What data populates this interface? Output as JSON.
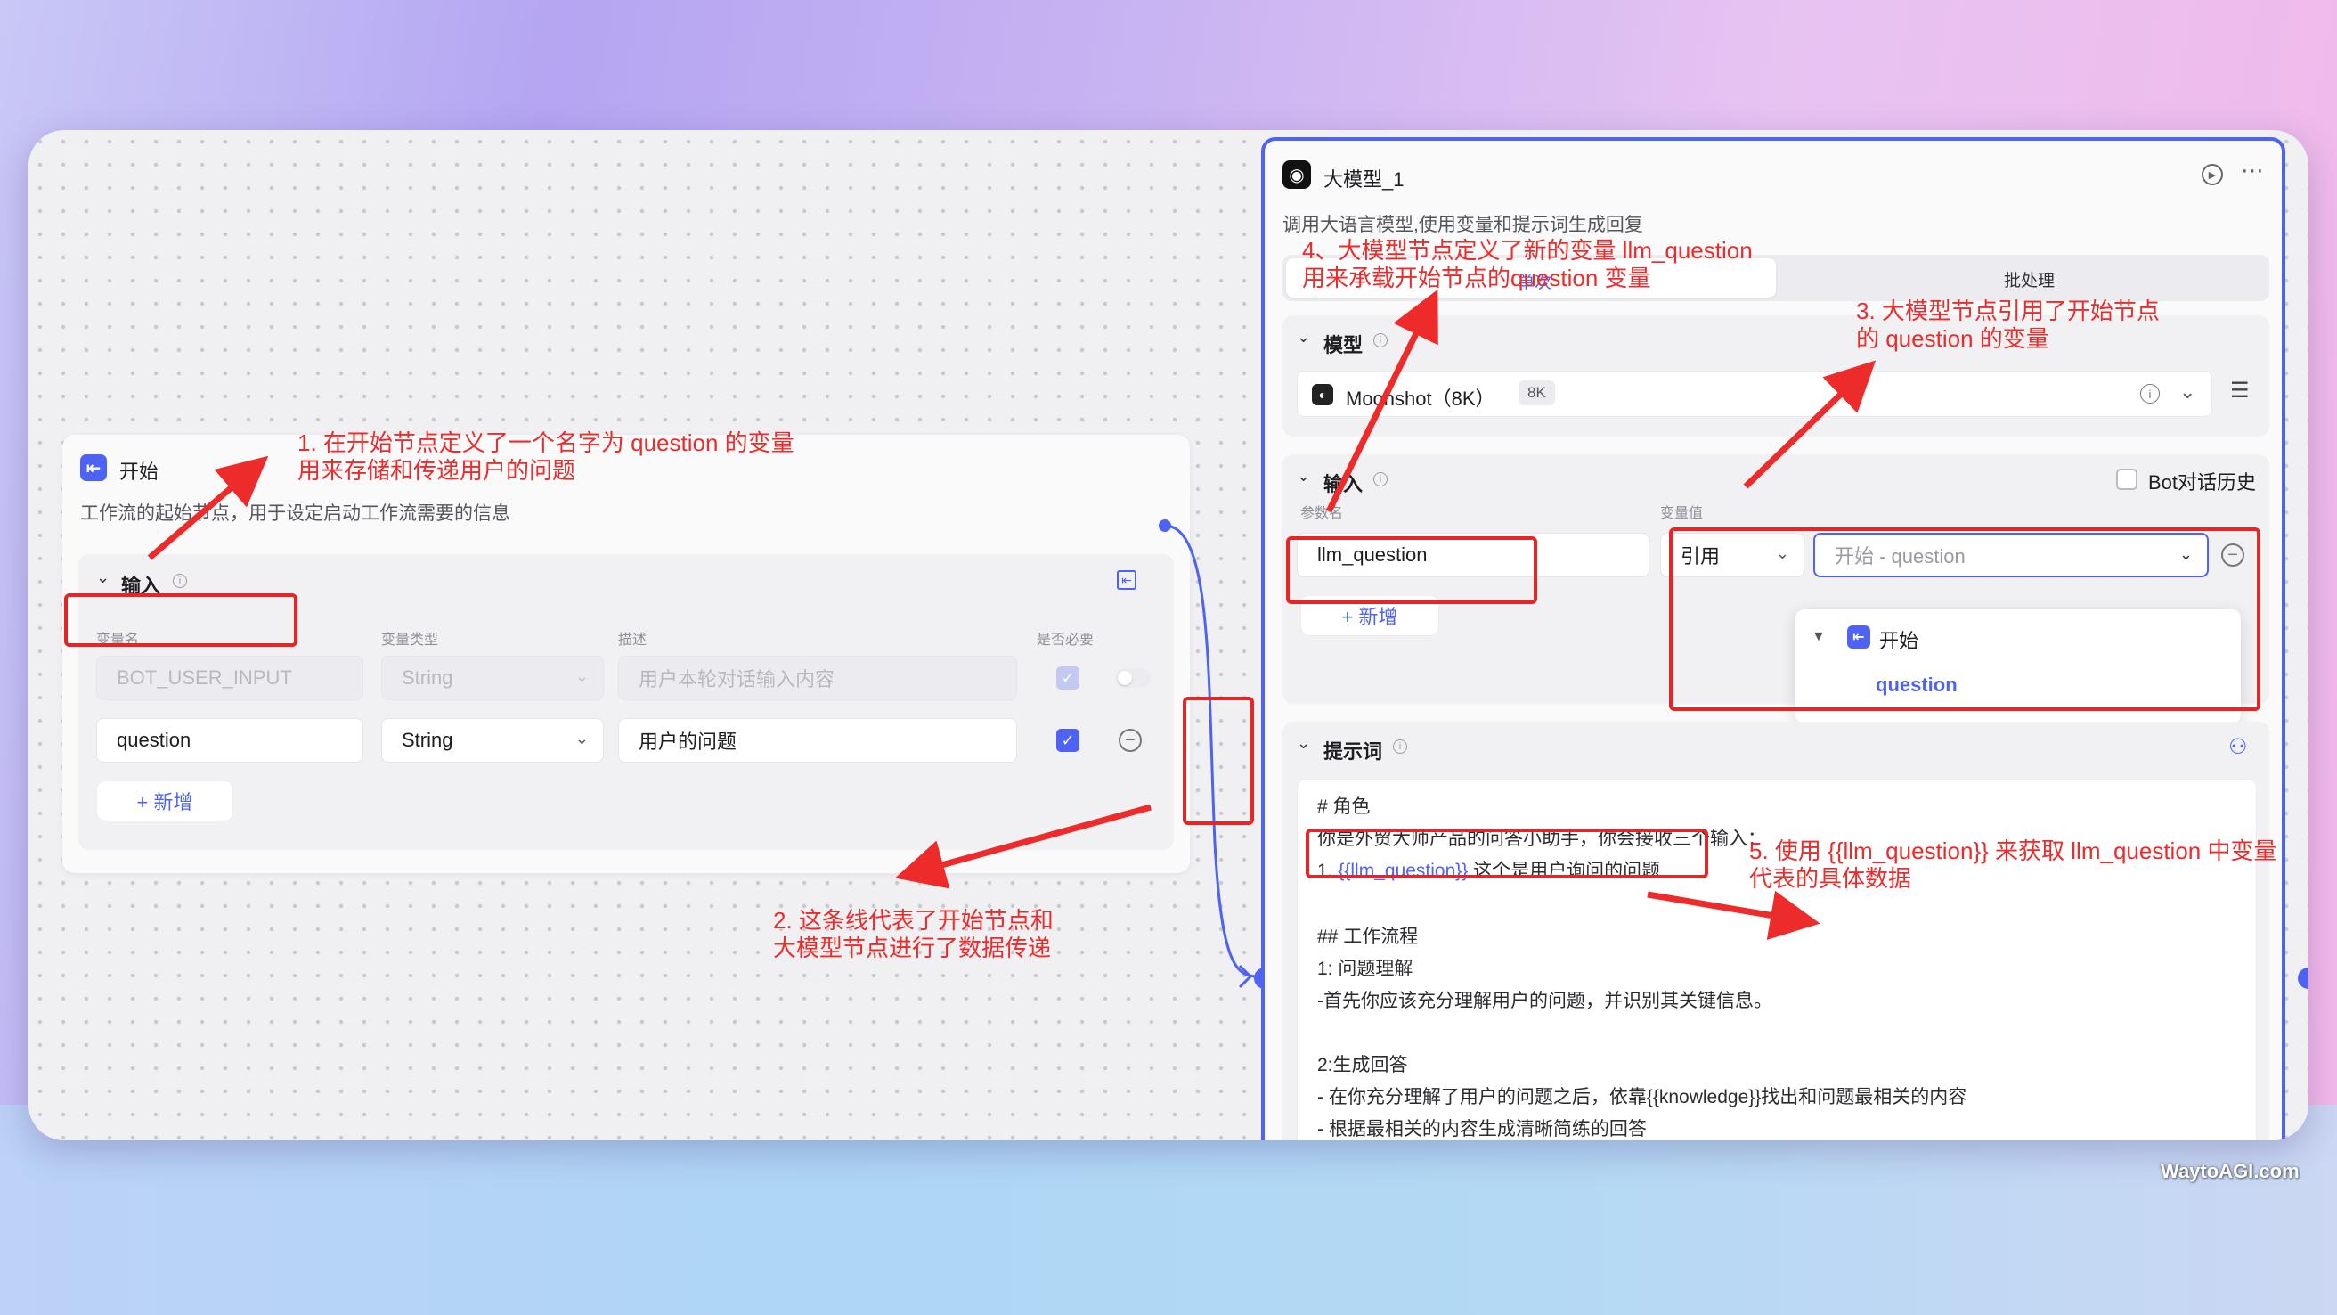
{
  "start_node": {
    "title": "开始",
    "description": "工作流的起始节点，用于设定启动工作流需要的信息",
    "input_section": {
      "title": "输入",
      "col_name": "变量名",
      "col_type": "变量类型",
      "col_desc": "描述",
      "col_required": "是否必要",
      "rows": [
        {
          "name": "BOT_USER_INPUT",
          "type": "String",
          "desc": "用户本轮对话输入内容"
        },
        {
          "name": "question",
          "type": "String",
          "desc": "用户的问题"
        }
      ],
      "add_label": "+ 新增"
    }
  },
  "llm_node": {
    "title": "大模型_1",
    "description": "调用大语言模型,使用变量和提示词生成回复",
    "tab_single": "单次",
    "tab_batch": "批处理",
    "model_section": {
      "title": "模型",
      "model_name": "Moonshot（8K）",
      "badge": "8K"
    },
    "input_section": {
      "title": "输入",
      "bot_history_label": "Bot对话历史",
      "col_param": "参数名",
      "col_value": "变量值",
      "param_name": "llm_question",
      "ref_type": "引用",
      "ref_value": "开始 - question",
      "add_label": "+ 新增",
      "dropdown_group": "开始",
      "dropdown_item": "question"
    },
    "prompt_section": {
      "title": "提示词",
      "lines": {
        "l1": "# 角色",
        "l2": "你是外贸大师产品的问答小助手，你会接收三个输入：",
        "l3_prefix": "1. ",
        "l3_var": "{{llm_question}}",
        "l3_suffix": " 这个是用户询问的问题",
        "l4": "## 工作流程",
        "l5": "1: 问题理解",
        "l6": "-首先你应该充分理解用户的问题，并识别其关键信息。",
        "l7": "2:生成回答",
        "l8": "- 在你充分理解了用户的问题之后，依靠{{knowledge}}找出和问题最相关的内容",
        "l9": "- 根据最相关的内容生成清晰简练的回答"
      }
    }
  },
  "annotations": {
    "a1_l1": "1. 在开始节点定义了一个名字为 question 的变量",
    "a1_l2": "用来存储和传递用户的问题",
    "a2_l1": "2. 这条线代表了开始节点和",
    "a2_l2": "大模型节点进行了数据传递",
    "a3_l1": "3. 大模型节点引用了开始节点",
    "a3_l2": "的 question 的变量",
    "a4_l1": "4、大模型节点定义了新的变量 llm_question",
    "a4_l2": "用来承载开始节点的question 变量",
    "a5_l1": "5. 使用 {{llm_question}} 来获取 llm_question 中变量",
    "a5_l2": "代表的具体数据"
  },
  "watermark": "WaytoAGI.com",
  "colors": {
    "accent": "#4e63f2",
    "annotation": "#ee2b2b"
  }
}
